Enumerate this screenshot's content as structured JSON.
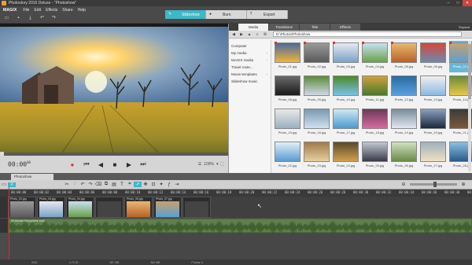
{
  "window": {
    "title": "Photostory 2016 Deluxe - \"Photoshow\""
  },
  "menu": {
    "logo": "MAGIX",
    "items": [
      "File",
      "Edit",
      "Effects",
      "Share",
      "Help"
    ]
  },
  "modes": [
    {
      "label": "Slideshow",
      "active": true
    },
    {
      "label": "Burn",
      "active": false
    },
    {
      "label": "Export",
      "active": false
    }
  ],
  "preview": {
    "time": "00:00",
    "time_suffix": "00",
    "zoom": "100%"
  },
  "mediapool": {
    "tabs": [
      {
        "label": "Media",
        "active": true
      },
      {
        "label": "Transitions",
        "active": false
      },
      {
        "label": "Title",
        "active": false
      },
      {
        "label": "Effects",
        "active": false
      }
    ],
    "expand_label": "Expand",
    "path": "D:\\Photos\\Photoshow",
    "sidebar": [
      {
        "label": "Computer",
        "chev": ""
      },
      {
        "label": "My media",
        "chev": "›"
      },
      {
        "label": "MAGIX media",
        "chev": "›"
      },
      {
        "label": "Travel route...",
        "chev": ""
      },
      {
        "label": "Movie templates",
        "chev": "›"
      },
      {
        "label": "Slideshow music",
        "chev": ""
      }
    ],
    "thumbs": [
      {
        "name": "Photo_01.jpg",
        "used": true,
        "c1": "#f0b43c",
        "c2": "#4a6a9a"
      },
      {
        "name": "Photo_02.jpg",
        "used": true,
        "c1": "#5a5a5a",
        "c2": "#9a9a9a"
      },
      {
        "name": "Photo_03.jpg",
        "used": true,
        "c1": "#7aa2c8",
        "c2": "#e8e8f0"
      },
      {
        "name": "Photo_04.jpg",
        "used": true,
        "c1": "#6aa04a",
        "c2": "#c8e0f0"
      },
      {
        "name": "Photo_05.jpg",
        "used": true,
        "c1": "#b8622a",
        "c2": "#e8b870"
      },
      {
        "name": "Photo_06.jpg",
        "used": false,
        "c1": "#6a8ab0",
        "c2": "#d24a3a"
      },
      {
        "name": "Photo_07.jpg",
        "used": true,
        "c1": "#5aa0d0",
        "c2": "#c8a070",
        "selected": true
      },
      {
        "name": "Photo_08.jpg",
        "used": false,
        "c1": "#1a1a1a",
        "c2": "#6a6a6a"
      },
      {
        "name": "Photo_09.jpg",
        "used": false,
        "c1": "#d0d8e8",
        "c2": "#5a8a3a"
      },
      {
        "name": "Photo_10.jpg",
        "used": false,
        "c1": "#7ac0e8",
        "c2": "#4a8a2a"
      },
      {
        "name": "Photo_11.jpg",
        "used": false,
        "c1": "#4a7a2a",
        "c2": "#d0a040"
      },
      {
        "name": "Photo_12.jpg",
        "used": false,
        "c1": "#5aa0e0",
        "c2": "#2a6aa0"
      },
      {
        "name": "Photo_13.jpg",
        "used": false,
        "c1": "#8ab8e0",
        "c2": "#f0f0f0"
      },
      {
        "name": "Photo_14.jpg",
        "used": false,
        "c1": "#e8c84a",
        "c2": "#6a8a3a"
      },
      {
        "name": "Photo_15.jpg",
        "used": false,
        "c1": "#9ab0c0",
        "c2": "#e8e8e8"
      },
      {
        "name": "Photo_16.jpg",
        "used": false,
        "c1": "#d0e0f0",
        "c2": "#7a9ab0"
      },
      {
        "name": "Photo_17.jpg",
        "used": false,
        "c1": "#4a9ad0",
        "c2": "#d0e8f0"
      },
      {
        "name": "Photo_18.jpg",
        "used": false,
        "c1": "#d86aa0",
        "c2": "#6a3a5a"
      },
      {
        "name": "Photo_19.jpg",
        "used": false,
        "c1": "#e0e8f0",
        "c2": "#7a8a9a"
      },
      {
        "name": "Photo_20.jpg",
        "used": false,
        "c1": "#1a2a3a",
        "c2": "#8aa0c0"
      },
      {
        "name": "Photo_21.jpg",
        "used": false,
        "c1": "#7a5a3a",
        "c2": "#3a3a3a"
      },
      {
        "name": "Photo_22.jpg",
        "used": false,
        "c1": "#5a9ad0",
        "c2": "#e0f0f8"
      },
      {
        "name": "Photo_23.jpg",
        "used": false,
        "c1": "#e8d0a0",
        "c2": "#a07a4a"
      },
      {
        "name": "Photo_24.jpg",
        "used": false,
        "c1": "#d0a050",
        "c2": "#5a4a2a"
      },
      {
        "name": "Photo_25.jpg",
        "used": false,
        "c1": "#3a3a4a",
        "c2": "#c0c8d0"
      },
      {
        "name": "Photo_26.jpg",
        "used": false,
        "c1": "#6a8a4a",
        "c2": "#d0e0c0"
      },
      {
        "name": "Photo_27.jpg",
        "used": false,
        "c1": "#f0e0c0",
        "c2": "#a0b0c0"
      },
      {
        "name": "Photo_28.jpg",
        "used": false,
        "c1": "#2a5a8a",
        "c2": "#8ac0e0"
      }
    ]
  },
  "timeline": {
    "tab": "Photoshow",
    "ruler": [
      "00:00:00",
      "00:00:02",
      "00:00:04",
      "00:00:06",
      "00:00:08",
      "00:00:10",
      "00:00:12",
      "00:00:14",
      "00:00:16",
      "00:00:18",
      "00:00:20",
      "00:00:22",
      "00:00:24",
      "00:00:26",
      "00:00:28",
      "00:00:30",
      "00:00:32",
      "00:00:34",
      "00:00:36",
      "00:00:38",
      "00:00:40"
    ],
    "clips": [
      {
        "label": "Photo_02.jpg",
        "c1": "#5a5a5a",
        "c2": "#9a9a9a"
      },
      {
        "label": "Photo_03.jpg",
        "c1": "#7aa2c8",
        "c2": "#e8e8f0"
      },
      {
        "label": "Photo_04.jpg",
        "c1": "#6aa04a",
        "c2": "#c8e0f0"
      },
      {
        "label": "",
        "c1": "#444",
        "c2": "#444"
      },
      {
        "label": "Photo_05.jpg",
        "c1": "#b8622a",
        "c2": "#e8b870"
      },
      {
        "label": "Photo_07.jpg",
        "c1": "#5aa0d0",
        "c2": "#c8a070"
      },
      {
        "label": "",
        "c1": "#444",
        "c2": "#444"
      }
    ],
    "audio_label": "06 Almost Everywhere.mp3",
    "status": [
      "0001",
      "4.73 Gt",
      "187 MB",
      "384 MB",
      "Photos: 6"
    ]
  },
  "colors": {
    "accent": "#3fb7c6",
    "playhead": "#e23",
    "audio": "#5f7f4c"
  }
}
